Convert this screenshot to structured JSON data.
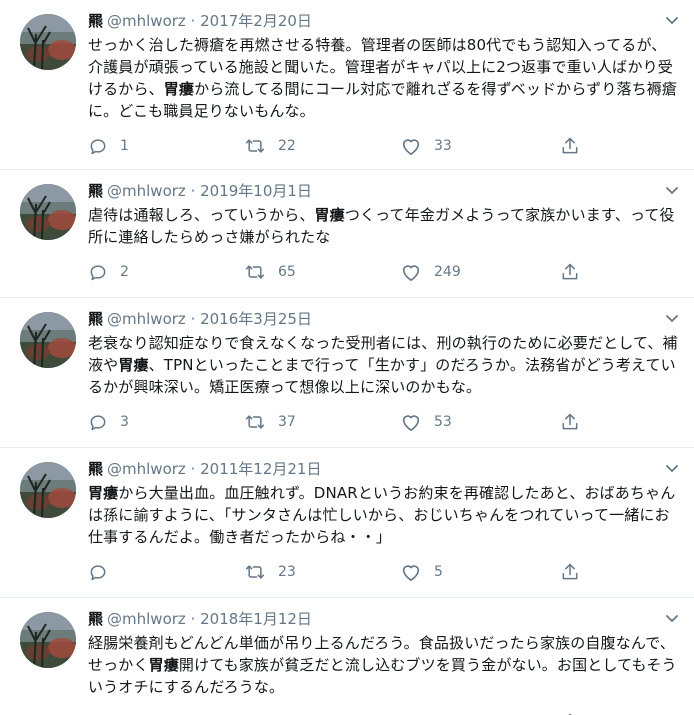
{
  "tweets": [
    {
      "name": "羆",
      "handle": "@mhlworz",
      "sep": "·",
      "date": "2017年2月20日",
      "text_html": "せっかく治した褥瘡を再燃させる特養。管理者の医師は80代でもう認知入ってるが、介護員が頑張っている施設と聞いた。管理者がキャパ以上に2つ返事で重い人ばかり受けるから、<b>胃瘻</b>から流してる間にコール対応で離れざるを得ずベッドからずり落ち褥瘡に。どこも職員足りないもんな。",
      "replies": "1",
      "retweets": "22",
      "likes": "33"
    },
    {
      "name": "羆",
      "handle": "@mhlworz",
      "sep": "·",
      "date": "2019年10月1日",
      "text_html": "虐待は通報しろ、っていうから、<b>胃瘻</b>つくって年金ガメようって家族かいます、って役所に連絡したらめっさ嫌がられたな",
      "replies": "2",
      "retweets": "65",
      "likes": "249"
    },
    {
      "name": "羆",
      "handle": "@mhlworz",
      "sep": "·",
      "date": "2016年3月25日",
      "text_html": "老衰なり認知症なりで食えなくなった受刑者には、刑の執行のために必要だとして、補液や<b>胃瘻</b>、TPNといったことまで行って「生かす」のだろうか。法務省がどう考えているかが興味深い。矯正医療って想像以上に深いのかもな。",
      "replies": "3",
      "retweets": "37",
      "likes": "53"
    },
    {
      "name": "羆",
      "handle": "@mhlworz",
      "sep": "·",
      "date": "2011年12月21日",
      "text_html": "<b>胃瘻</b>から大量出血。血圧触れず。DNARというお約束を再確認したあと、おばあちゃんは孫に諭すように、「サンタさんは忙しいから、おじいちゃんをつれていって一緒にお仕事するんだよ。働き者だったからね・・」",
      "replies": "",
      "retweets": "23",
      "likes": "5"
    },
    {
      "name": "羆",
      "handle": "@mhlworz",
      "sep": "·",
      "date": "2018年1月12日",
      "text_html": "経腸栄養剤もどんどん単価が吊り上るんだろう。食品扱いだったら家族の自腹なんで、せっかく<b>胃瘻</b>開けても家族が貧乏だと流し込むブツを買う金がない。お国としてもそういうオチにするんだろうな。",
      "replies": "",
      "retweets": "",
      "likes": ""
    }
  ],
  "icons": {
    "reply": "reply-icon",
    "retweet": "retweet-icon",
    "like": "heart-icon",
    "share": "share-icon",
    "caret": "chevron-down-icon"
  },
  "colors": {
    "text": "#14171a",
    "secondary": "#657786",
    "divider": "#e6ecf0"
  }
}
